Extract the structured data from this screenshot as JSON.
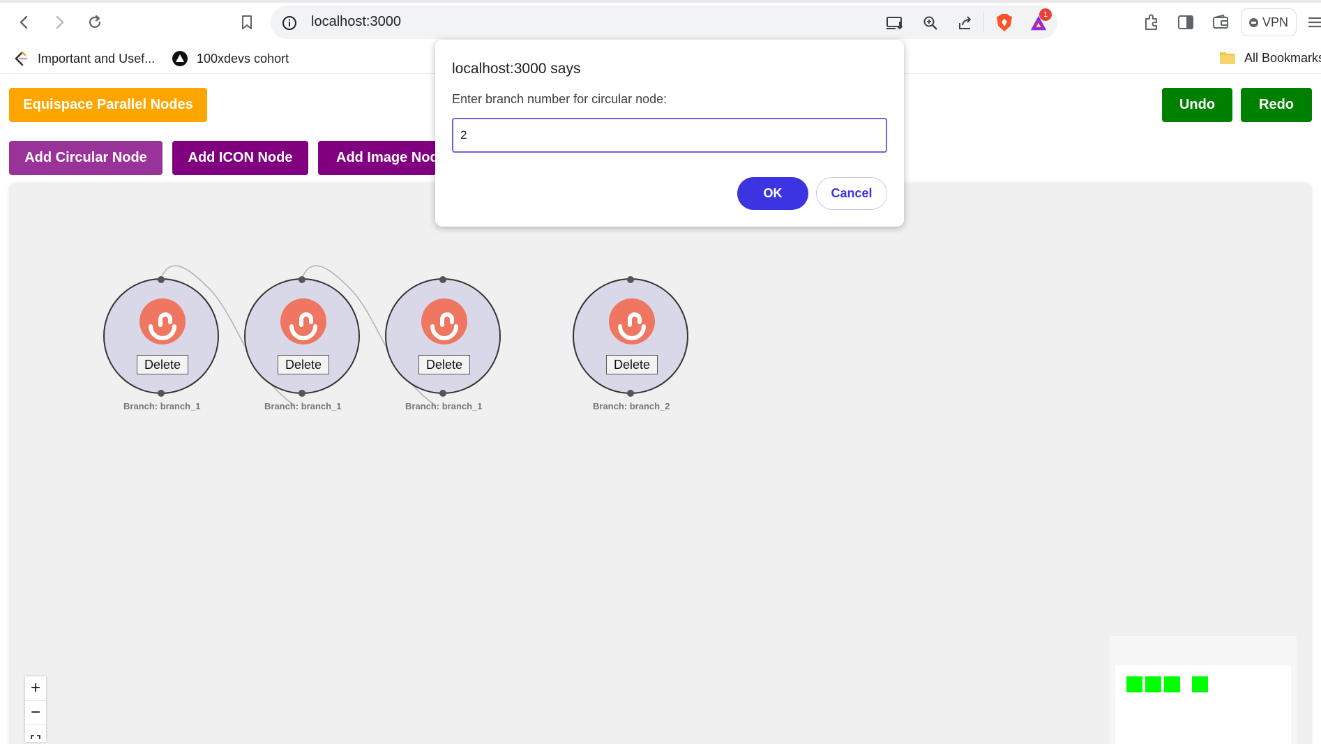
{
  "browser": {
    "url": "localhost:3000",
    "notification_count": "1",
    "vpn_label": "VPN",
    "bookmarks": [
      "Important and Usef...",
      "100xdevs cohort"
    ],
    "all_bookmarks_label": "All Bookmarks"
  },
  "toolbar": {
    "equispace_label": "Equispace Parallel Nodes",
    "add_circular_label": "Add Circular Node",
    "add_icon_label": "Add ICON Node",
    "add_image_label": "Add Image Node",
    "undo_label": "Undo",
    "redo_label": "Redo",
    "colors": {
      "equispace": "#ffa500",
      "add_circular": "#993399",
      "add_icon": "#800080",
      "add_image": "#800080",
      "undo_redo": "#008000"
    }
  },
  "nodes": [
    {
      "delete_label": "Delete",
      "branch_label": "Branch: branch_1"
    },
    {
      "delete_label": "Delete",
      "branch_label": "Branch: branch_1"
    },
    {
      "delete_label": "Delete",
      "branch_label": "Branch: branch_1"
    },
    {
      "delete_label": "Delete",
      "branch_label": "Branch: branch_2"
    }
  ],
  "zoom_controls": {
    "zoom_in": "+",
    "zoom_out": "−"
  },
  "dialog": {
    "title": "localhost:3000 says",
    "message": "Enter branch number for circular node:",
    "input_value": "2",
    "ok_label": "OK",
    "cancel_label": "Cancel"
  }
}
